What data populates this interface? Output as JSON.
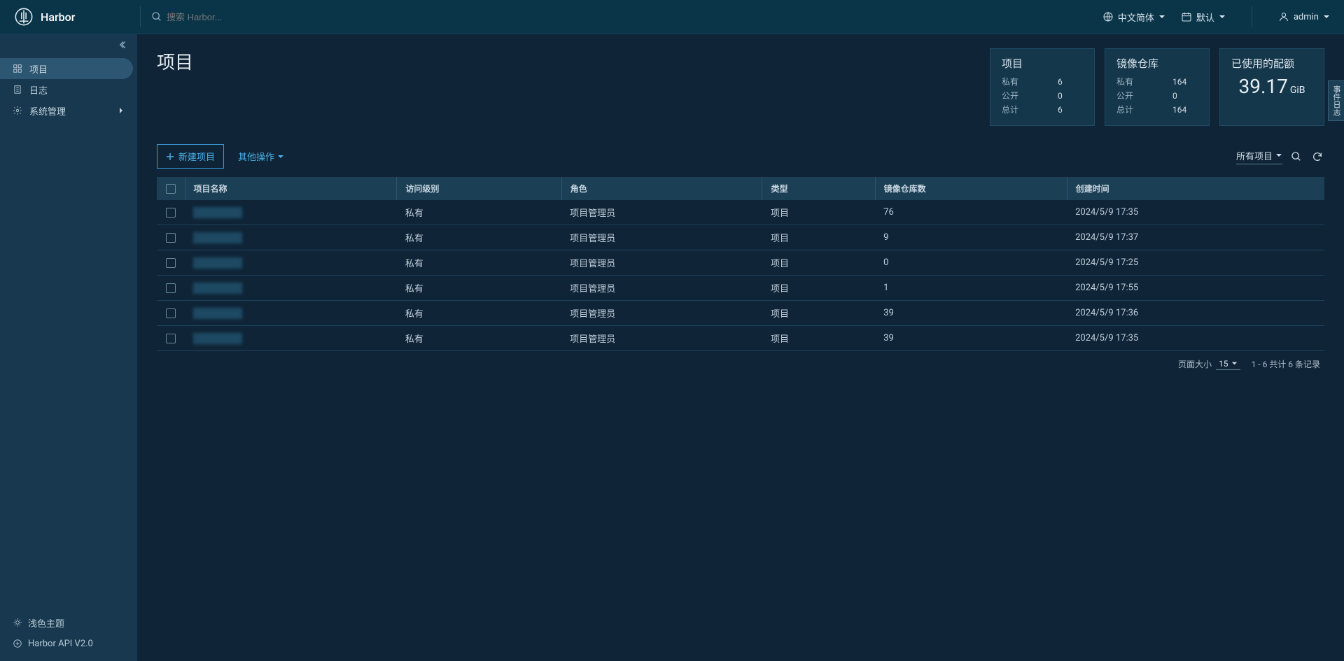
{
  "header": {
    "app_name": "Harbor",
    "search_placeholder": "搜索 Harbor...",
    "language_label": "中文简体",
    "default_label": "默认",
    "user_name": "admin"
  },
  "sidebar": {
    "items": [
      {
        "icon": "projects",
        "label": "项目",
        "active": true
      },
      {
        "icon": "logs",
        "label": "日志",
        "active": false
      },
      {
        "icon": "admin",
        "label": "系统管理",
        "active": false,
        "has_children": true
      }
    ],
    "theme_link": "浅色主题",
    "api_link": "Harbor API V2.0"
  },
  "page": {
    "title": "项目",
    "side_tab": "事件日志"
  },
  "stats": {
    "projects": {
      "title": "项目",
      "rows": [
        {
          "k": "私有",
          "v": "6"
        },
        {
          "k": "公开",
          "v": "0"
        },
        {
          "k": "总计",
          "v": "6"
        }
      ]
    },
    "repos": {
      "title": "镜像仓库",
      "rows": [
        {
          "k": "私有",
          "v": "164"
        },
        {
          "k": "公开",
          "v": "0"
        },
        {
          "k": "总计",
          "v": "164"
        }
      ]
    },
    "quota": {
      "title": "已使用的配额",
      "value": "39.17",
      "unit": "GiB"
    }
  },
  "actions": {
    "new_project": "新建项目",
    "other_actions": "其他操作",
    "filter": "所有项目"
  },
  "table": {
    "headers": [
      "项目名称",
      "访问级别",
      "角色",
      "类型",
      "镜像仓库数",
      "创建时间"
    ],
    "rows": [
      {
        "access": "私有",
        "role": "项目管理员",
        "type": "项目",
        "repos": "76",
        "created": "2024/5/9 17:35"
      },
      {
        "access": "私有",
        "role": "项目管理员",
        "type": "项目",
        "repos": "9",
        "created": "2024/5/9 17:37"
      },
      {
        "access": "私有",
        "role": "项目管理员",
        "type": "项目",
        "repos": "0",
        "created": "2024/5/9 17:25"
      },
      {
        "access": "私有",
        "role": "项目管理员",
        "type": "项目",
        "repos": "1",
        "created": "2024/5/9 17:55"
      },
      {
        "access": "私有",
        "role": "项目管理员",
        "type": "项目",
        "repos": "39",
        "created": "2024/5/9 17:36"
      },
      {
        "access": "私有",
        "role": "项目管理员",
        "type": "项目",
        "repos": "39",
        "created": "2024/5/9 17:35"
      }
    ]
  },
  "pagination": {
    "page_size_label": "页面大小",
    "page_size": "15",
    "range_text": "1 - 6 共计 6 条记录"
  }
}
